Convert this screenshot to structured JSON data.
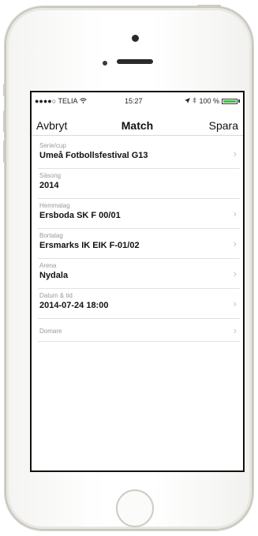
{
  "status": {
    "carrier": "●●●●○ TELIA",
    "wifi": "wifi-icon",
    "time": "15:27",
    "location": "location-arrow-icon",
    "bluetooth": "bluetooth-icon",
    "battery_text": "100 %",
    "battery_level": 1.0,
    "battery_color": "#3cc23c"
  },
  "nav": {
    "left": "Avbryt",
    "title": "Match",
    "right": "Spara"
  },
  "rows": [
    {
      "label": "Serie/cup",
      "value": "Umeå Fotbollsfestival G13"
    },
    {
      "label": "Säsong",
      "value": "2014"
    },
    {
      "label": "Hemmalag",
      "value": "Ersboda SK F 00/01"
    },
    {
      "label": "Bortalag",
      "value": "Ersmarks IK EIK  F-01/02"
    },
    {
      "label": "Arena",
      "value": "Nydala"
    },
    {
      "label": "Datum & tid",
      "value": "2014-07-24 18:00"
    },
    {
      "label": "Domare",
      "value": ""
    }
  ],
  "chevron": "›"
}
